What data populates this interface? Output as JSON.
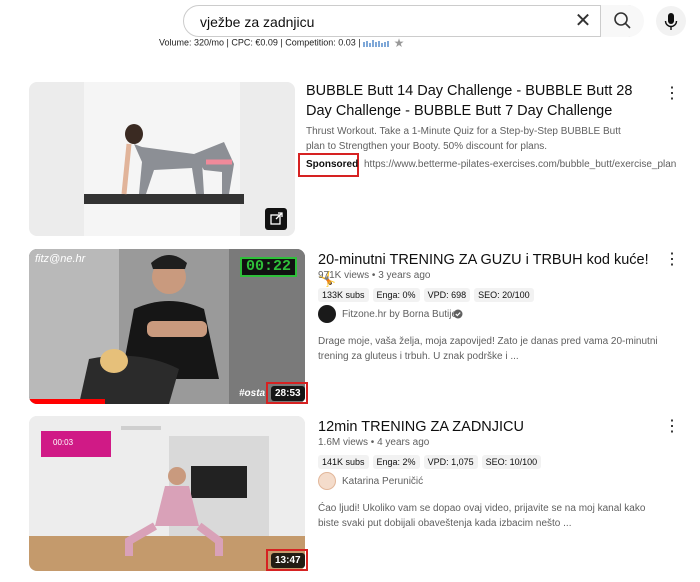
{
  "search": {
    "query": "vježbe za zadnjicu",
    "clear_icon": "close-icon",
    "search_icon": "search-icon",
    "mic_icon": "mic-icon"
  },
  "stats": {
    "text": "Volume: 320/mo | CPC: €0.09 | Competition: 0.03 |"
  },
  "results": [
    {
      "title": "BUBBLE Butt 14 Day Challenge - BUBBLE Butt 28 Day Challenge - BUBBLE Butt 7 Day Challenge",
      "description": "Thrust Workout. Take a 1-Minute Quiz for a Step-by-Step BUBBLE Butt plan to Strengthen your Booty. 50% discount for plans.",
      "badge": "Sponsored",
      "url": "https://www.betterme-pilates-exercises.com/bubble_butt/exercise_plan"
    },
    {
      "title": "20-minutni TRENING ZA GUZU i TRBUH kod kuće!🤸",
      "views": "971K views",
      "age": "3 years ago",
      "chips": [
        "133K subs",
        "Enga: 0%",
        "VPD: 698",
        "SEO: 20/100"
      ],
      "channel": "Fitzone.hr by Borna Butijer",
      "description": "Drage moje, vaša želja, moja zapovijed! Zato je danas pred vama 20-minutni trening za gluteus i trbuh. U znak podrške i ...",
      "duration": "28:53",
      "timer": "00:22",
      "watermark": "fitz@ne.hr",
      "overlay": "#osta"
    },
    {
      "title": "12min TRENING ZA ZADNJICU",
      "views": "1.6M views",
      "age": "4 years ago",
      "chips": [
        "141K subs",
        "Enga: 2%",
        "VPD: 1,075",
        "SEO: 10/100"
      ],
      "channel": "Katarina Peruničić",
      "description": "Ćao ljudi! Ukoliko vam se dopao ovaj video, prijavite se na moj kanal kako biste svaki put dobijali obaveštenja kada izbacim nešto ...",
      "duration": "13:47",
      "timer": "00:03"
    }
  ],
  "colors": {
    "highlight": "#d62222",
    "timer_green": "#2fbf3a",
    "progress_red": "#ff0000"
  }
}
